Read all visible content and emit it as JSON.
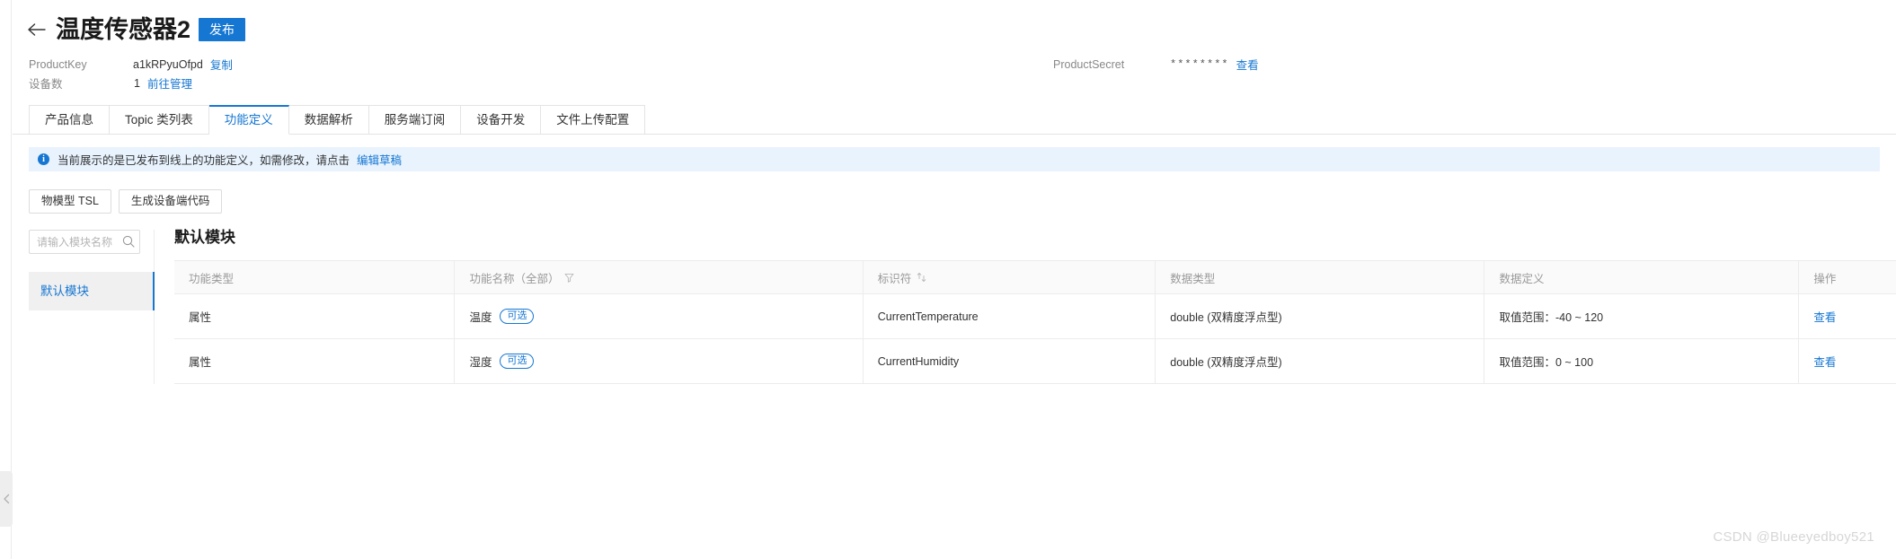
{
  "header": {
    "back_icon": "arrow-left-icon",
    "title": "温度传感器2",
    "publish_label": "发布"
  },
  "meta": {
    "product_key_label": "ProductKey",
    "product_key_value": "a1kRPyuOfpd",
    "copy_label": "复制",
    "device_count_label": "设备数",
    "device_count_value": "1",
    "manage_label": "前往管理",
    "product_secret_label": "ProductSecret",
    "product_secret_value": "********",
    "view_label": "查看"
  },
  "tabs": [
    {
      "label": "产品信息",
      "active": false
    },
    {
      "label": "Topic 类列表",
      "active": false
    },
    {
      "label": "功能定义",
      "active": true
    },
    {
      "label": "数据解析",
      "active": false
    },
    {
      "label": "服务端订阅",
      "active": false
    },
    {
      "label": "设备开发",
      "active": false
    },
    {
      "label": "文件上传配置",
      "active": false
    }
  ],
  "alert": {
    "icon": "info-circle-icon",
    "icon_glyph": "i",
    "text": "当前展示的是已发布到线上的功能定义，如需修改，请点击",
    "link": "编辑草稿"
  },
  "actions": {
    "tsl_label": "物模型 TSL",
    "gen_code_label": "生成设备端代码"
  },
  "sidebar": {
    "search_placeholder": "请输入模块名称",
    "search_value": "",
    "search_icon": "search-icon",
    "items": [
      {
        "label": "默认模块",
        "active": true
      }
    ]
  },
  "main": {
    "module_title": "默认模块",
    "table": {
      "columns": [
        {
          "label": "功能类型",
          "icon": ""
        },
        {
          "label": "功能名称（全部）",
          "icon": "filter-icon"
        },
        {
          "label": "标识符",
          "icon": "sort-icon"
        },
        {
          "label": "数据类型",
          "icon": ""
        },
        {
          "label": "数据定义",
          "icon": ""
        },
        {
          "label": "操作",
          "icon": ""
        }
      ],
      "rows": [
        {
          "function_type": "属性",
          "function_name": "温度",
          "badge": "可选",
          "identifier": "CurrentTemperature",
          "data_type": "double (双精度浮点型)",
          "data_definition": "取值范围：-40 ~ 120",
          "operation": "查看"
        },
        {
          "function_type": "属性",
          "function_name": "湿度",
          "badge": "可选",
          "identifier": "CurrentHumidity",
          "data_type": "double (双精度浮点型)",
          "data_definition": "取值范围：0 ~ 100",
          "operation": "查看"
        }
      ]
    }
  },
  "watermark": "CSDN @Blueeyedboy521",
  "colors": {
    "accent": "#1677d2",
    "alert_bg": "#e8f3fe",
    "header_bg": "#fafafa",
    "border": "#ececec"
  }
}
